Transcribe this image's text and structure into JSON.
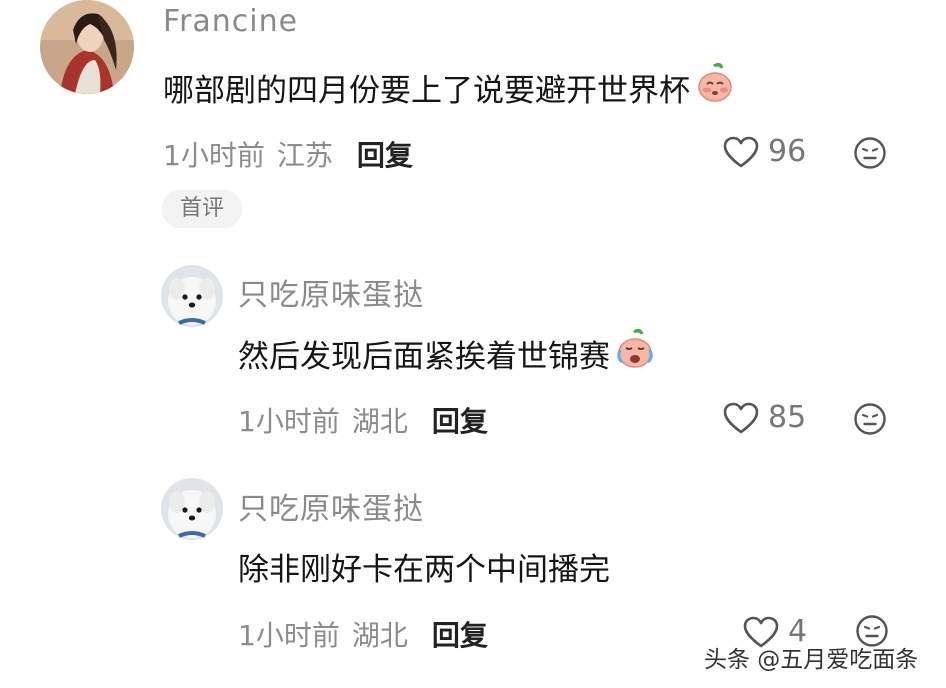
{
  "comments": [
    {
      "username": "Francine",
      "content": "哪部剧的四月份要上了说要避开世界杯",
      "time": "1小时前",
      "location": "江苏",
      "reply_label": "回复",
      "likes": "96",
      "badge": "首评",
      "emoji": "peach-shy-emoji"
    },
    {
      "username": "只吃原味蛋挞",
      "content": "然后发现后面紧挨着世锦赛",
      "time": "1小时前",
      "location": "湖北",
      "reply_label": "回复",
      "likes": "85",
      "emoji": "peach-cry-emoji"
    },
    {
      "username": "只吃原味蛋挞",
      "content": "除非刚好卡在两个中间播完",
      "time": "1小时前",
      "location": "湖北",
      "reply_label": "回复",
      "likes": "4"
    }
  ],
  "watermark": "头条 @五月爱吃面条",
  "icons": {
    "like": "heart-outline-icon",
    "dislike": "neutral-face-icon"
  },
  "colors": {
    "text": "#161616",
    "meta": "#8c8c8c",
    "badge_bg": "#f3f3f3"
  }
}
